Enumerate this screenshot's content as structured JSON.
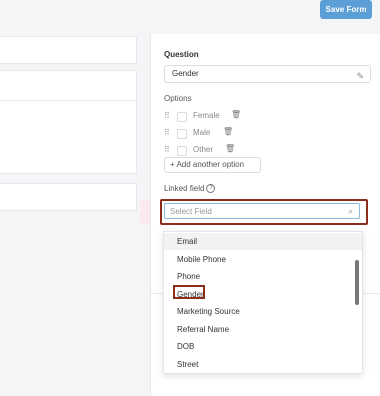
{
  "toolbar": {
    "save_label": "Save Form"
  },
  "panel": {
    "question_label": "Question",
    "question_value": "Gender",
    "options_label": "Options",
    "options": [
      {
        "label": "Female"
      },
      {
        "label": "Male"
      },
      {
        "label": "Other"
      }
    ],
    "add_option": "+ Add another option",
    "linked_field_label": "Linked field",
    "select_placeholder": "Select Field"
  },
  "dropdown": {
    "items": [
      "Email",
      "Mobile Phone",
      "Phone",
      "Gender",
      "Marketing Source",
      "Referral Name",
      "DOB",
      "Street"
    ],
    "hovered": "Email",
    "highlighted": "Gender"
  },
  "colors": {
    "accent": "#5b9fd6",
    "highlight_outline": "#8b2d1a"
  },
  "icons": {
    "pen": "pen-icon",
    "trash": "trash-icon",
    "drag": "drag-handle-icon",
    "search": "search-icon",
    "help": "help-icon"
  }
}
